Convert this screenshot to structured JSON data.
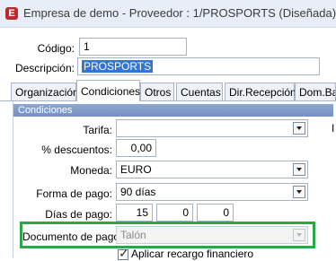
{
  "window": {
    "app_icon_letter": "E",
    "title": "Empresa de demo - Proveedor : 1/PROSPORTS (Diseñada)"
  },
  "header_fields": {
    "codigo_label": "Código:",
    "codigo_value": "1",
    "descripcion_label": "Descripción:",
    "descripcion_value": "PROSPORTS"
  },
  "tabs": [
    {
      "label": "Organización",
      "active": false
    },
    {
      "label": "Condiciones",
      "active": true
    },
    {
      "label": "Otros",
      "active": false
    },
    {
      "label": "Cuentas",
      "active": false
    },
    {
      "label": "Dir.Recepción",
      "active": false
    },
    {
      "label": "Dom.Ban",
      "active": false
    }
  ],
  "section": {
    "title": "Condiciones",
    "side_letter": "I"
  },
  "form": {
    "tarifa_label": "Tarifa:",
    "tarifa_value": "",
    "descuentos_label": "% descuentos:",
    "descuentos_value": "0,00",
    "moneda_label": "Moneda:",
    "moneda_value": "EURO",
    "forma_pago_label": "Forma de pago:",
    "forma_pago_value": "90 días",
    "dias_pago_label": "Días de pago:",
    "dias_pago_values": [
      "15",
      "0",
      "0"
    ],
    "documento_pago_label": "Documento de pago:",
    "documento_pago_value": "Talón",
    "recargo_label": "Aplicar recargo financiero",
    "recargo_checked": true
  },
  "colors": {
    "highlight": "#2fa54a",
    "selection": "#3375d6",
    "section_header": "#7f99c9"
  }
}
